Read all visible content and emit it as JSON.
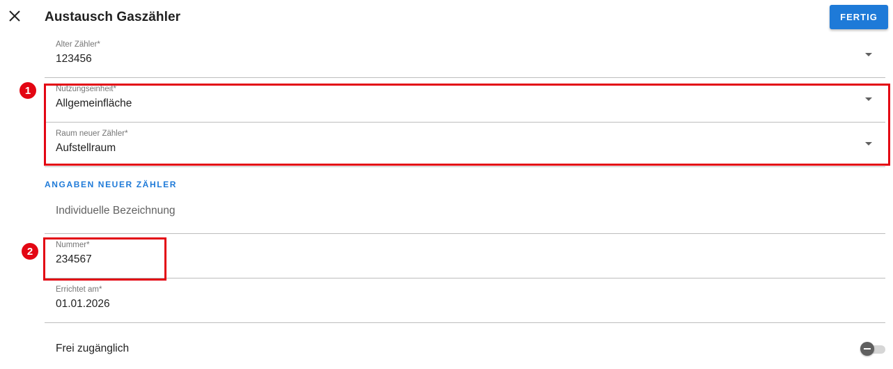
{
  "header": {
    "title": "Austausch Gaszähler",
    "done_label": "FERTIG"
  },
  "fields": {
    "old_meter": {
      "label": "Alter Zähler*",
      "value": "123456"
    },
    "usage_unit": {
      "label": "Nutzungseinheit*",
      "value": "Allgemeinfläche"
    },
    "room": {
      "label": "Raum neuer Zähler*",
      "value": "Aufstellraum"
    },
    "individual_name": {
      "placeholder": "Individuelle Bezeichnung"
    },
    "number": {
      "label": "Nummer*",
      "value": "234567"
    },
    "installed_on": {
      "label": "Errichtet am*",
      "value": "01.01.2026"
    }
  },
  "section": {
    "new_meter_heading": "ANGABEN NEUER ZÄHLER"
  },
  "toggle": {
    "label": "Frei zugänglich",
    "state": "off"
  },
  "annotations": [
    {
      "number": "1"
    },
    {
      "number": "2"
    }
  ],
  "colors": {
    "accent": "#1e7ad8",
    "annotation": "#e30613",
    "text": "#212121",
    "label": "#757575",
    "divider": "#bdbdbd"
  },
  "icons": {
    "close": "close-icon",
    "dropdown": "chevron-down-icon"
  }
}
